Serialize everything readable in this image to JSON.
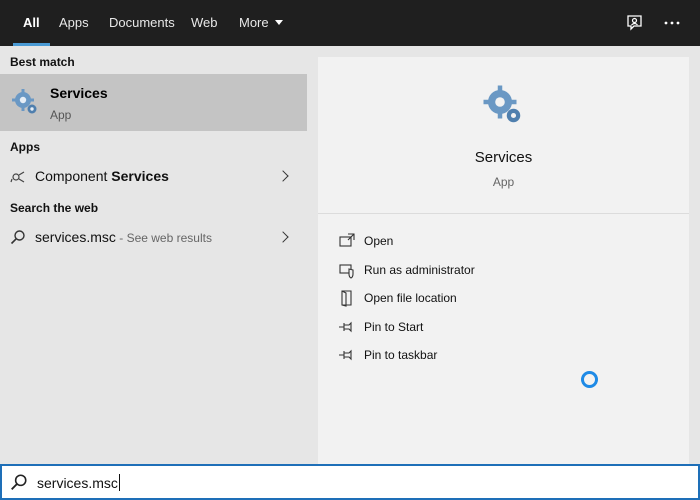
{
  "tabs": [
    {
      "label": "All",
      "active": true
    },
    {
      "label": "Apps"
    },
    {
      "label": "Documents"
    },
    {
      "label": "Web"
    },
    {
      "label": "More"
    }
  ],
  "top_icons": [
    "feedback-icon",
    "more-options-icon"
  ],
  "left": {
    "best_match_heading": "Best match",
    "best_match": {
      "title": "Services",
      "subtitle": "App",
      "icon": "services-gear-icon"
    },
    "apps_heading": "Apps",
    "apps": [
      {
        "prefix": "Component ",
        "bold": "Services",
        "icon": "component-services-icon"
      }
    ],
    "web_heading": "Search the web",
    "web": [
      {
        "query": "services.msc",
        "suffix": " - See web results",
        "icon": "search-icon"
      }
    ]
  },
  "preview": {
    "title": "Services",
    "subtitle": "App",
    "icon": "services-gear-icon",
    "actions": [
      {
        "label": "Open",
        "icon": "open-icon"
      },
      {
        "label": "Run as administrator",
        "icon": "shield-icon"
      },
      {
        "label": "Open file location",
        "icon": "folder-icon"
      },
      {
        "label": "Pin to Start",
        "icon": "pin-icon"
      },
      {
        "label": "Pin to taskbar",
        "icon": "pin-icon"
      }
    ]
  },
  "search": {
    "value": "services.msc",
    "icon": "search-icon"
  },
  "colors": {
    "accent": "#1e6fb8",
    "spinner": "#1e8ae6",
    "topbar": "#1f1f1f",
    "selected": "#c4c4c4"
  }
}
